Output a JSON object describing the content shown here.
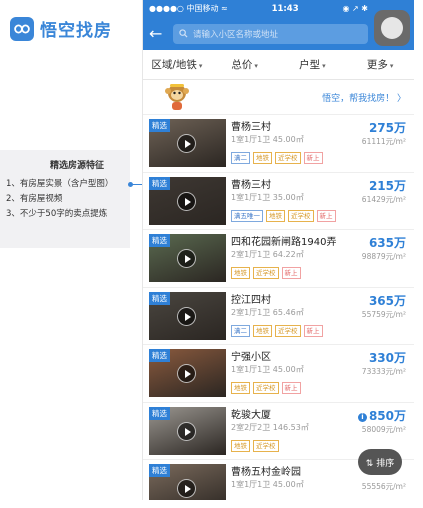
{
  "brand": {
    "name": "悟空找房"
  },
  "annotation": {
    "title": "精选房源特征",
    "lines": [
      "1、有房屋实景（含户型图）",
      "2、有房屋视频",
      "3、不少于50字的卖点提炼"
    ]
  },
  "status_bar": {
    "carrier": "●●●●○ 中国移动 ≈",
    "time": "11:43",
    "right": "◉ ↗ ✱"
  },
  "search": {
    "placeholder": "请输入小区名称或地址"
  },
  "filters": [
    "区域/地铁",
    "总价",
    "户型",
    "更多"
  ],
  "helper": {
    "link": "悟空，帮我找房！ 〉"
  },
  "listing_tag": "精选",
  "listings": [
    {
      "title": "曹杨三村",
      "sub": "1室1厅1卫  45.00㎡",
      "price": "275万",
      "unit": "61111元/m²",
      "tags": [
        "满二",
        "地铁",
        "近学校",
        "新上"
      ],
      "thumb": "#6e6256",
      "has_info": false
    },
    {
      "title": "曹杨三村",
      "sub": "1室1厅1卫  35.00㎡",
      "price": "215万",
      "unit": "61429元/m²",
      "tags": [
        "满五唯一",
        "地铁",
        "近学校",
        "新上"
      ],
      "thumb": "#3e3833",
      "has_info": false
    },
    {
      "title": "四和花园新闸路1940弄",
      "sub": "2室1厅1卫  64.22㎡",
      "price": "635万",
      "unit": "98879元/m²",
      "tags": [
        "地铁",
        "近学校",
        "新上"
      ],
      "thumb": "#5a6a50",
      "has_info": false
    },
    {
      "title": "控江四村",
      "sub": "2室1厅1卫  65.46㎡",
      "price": "365万",
      "unit": "55759元/m²",
      "tags": [
        "满二",
        "地铁",
        "近学校",
        "新上"
      ],
      "thumb": "#4a4640",
      "has_info": false
    },
    {
      "title": "宁强小区",
      "sub": "1室1厅1卫  45.00㎡",
      "price": "330万",
      "unit": "73333元/m²",
      "tags": [
        "地铁",
        "近学校",
        "新上"
      ],
      "thumb": "#8a5a3e",
      "has_info": false
    },
    {
      "title": "乾骏大厦",
      "sub": "2室2厅2卫  146.53㎡",
      "price": "850万",
      "unit": "58009元/m²",
      "tags": [
        "地铁",
        "近学校"
      ],
      "thumb": "#9a9690",
      "has_info": true
    },
    {
      "title": "曹杨五村金岭园",
      "sub": "1室1厅1卫  45.00㎡",
      "price": "",
      "unit": "55556元/m²",
      "tags": [],
      "thumb": "#7a6a5c",
      "has_info": false
    }
  ],
  "sort_button": "⇅ 排序",
  "colors": {
    "brand_blue": "#2f80d6",
    "tag_orange": "#d79a2a"
  }
}
